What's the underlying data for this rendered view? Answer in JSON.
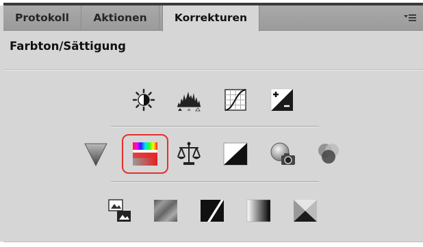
{
  "tabs": [
    {
      "label": "Protokoll",
      "active": false
    },
    {
      "label": "Aktionen",
      "active": false
    },
    {
      "label": "Korrekturen",
      "active": true
    }
  ],
  "panel_menu_icon": "panel-menu-icon",
  "adjustment_title": "Farbton/Sättigung",
  "icon_rows": [
    [
      "brightness-contrast-icon",
      "levels-icon",
      "curves-icon",
      "exposure-icon"
    ],
    [
      "vibrance-icon",
      "hue-saturation-icon",
      "color-balance-icon",
      "black-white-icon",
      "photo-filter-icon",
      "channel-mixer-icon"
    ],
    [
      "invert-icon",
      "posterize-icon",
      "threshold-icon",
      "gradient-map-icon",
      "selective-color-icon"
    ]
  ],
  "selected_icon": "hue-saturation-icon",
  "selection_color": "#e3302a"
}
